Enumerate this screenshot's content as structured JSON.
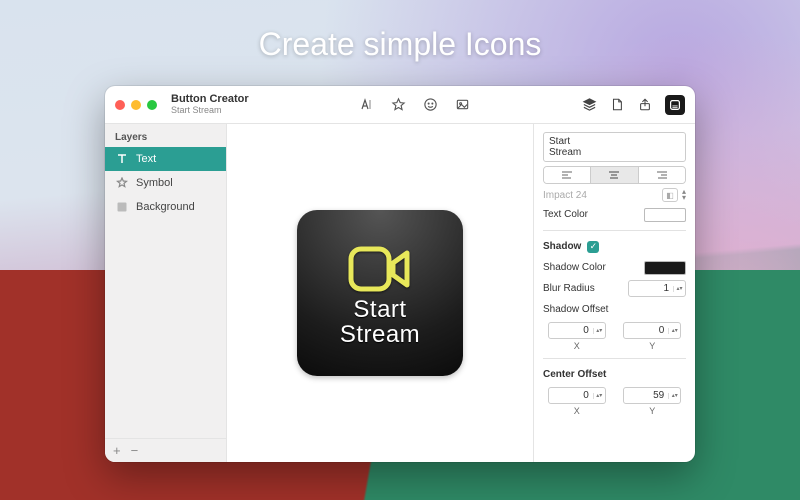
{
  "headline": "Create simple Icons",
  "window": {
    "title": "Button Creator",
    "subtitle": "Start Stream"
  },
  "sidebar": {
    "title": "Layers",
    "items": [
      {
        "label": "Text",
        "selected": true
      },
      {
        "label": "Symbol",
        "selected": false
      },
      {
        "label": "Background",
        "selected": false
      }
    ]
  },
  "preview": {
    "line1": "Start",
    "line2": "Stream"
  },
  "inspector": {
    "text_value": "Start\nStream",
    "font_label": "Impact 24",
    "text_color_label": "Text Color",
    "shadow": {
      "title": "Shadow",
      "enabled": true,
      "color_label": "Shadow Color",
      "blur_label": "Blur Radius",
      "blur_value": "1",
      "offset_label": "Shadow Offset",
      "x": "0",
      "y": "0",
      "x_label": "X",
      "y_label": "Y"
    },
    "center_offset": {
      "title": "Center Offset",
      "x": "0",
      "y": "59",
      "x_label": "X",
      "y_label": "Y"
    }
  }
}
